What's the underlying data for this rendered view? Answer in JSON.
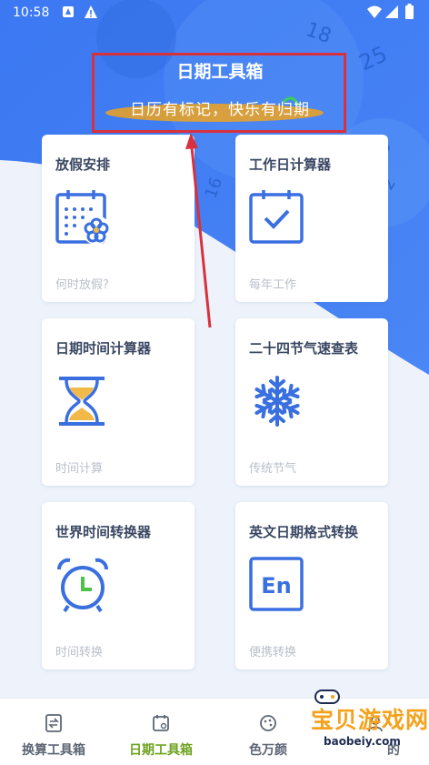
{
  "status_bar": {
    "time": "10:58"
  },
  "header": {
    "title": "日期工具箱",
    "subtitle": "日历有标记，快乐有归期"
  },
  "cards": [
    {
      "title": "放假安排",
      "subtitle": "何时放假?",
      "icon": "calendar-flower-icon"
    },
    {
      "title": "工作日计算器",
      "subtitle": "每年工作",
      "icon": "calendar-check-icon"
    },
    {
      "title": "日期时间计算器",
      "subtitle": "时间计算",
      "icon": "hourglass-icon"
    },
    {
      "title": "二十四节气速查表",
      "subtitle": "传统节气",
      "icon": "snowflake-icon"
    },
    {
      "title": "世界时间转换器",
      "subtitle": "时间转换",
      "icon": "alarm-clock-icon"
    },
    {
      "title": "英文日期格式转换",
      "subtitle": "便携转换",
      "icon": "en-icon"
    }
  ],
  "tabs": [
    {
      "label": "换算工具箱",
      "icon": "converter-icon"
    },
    {
      "label": "日期工具箱",
      "icon": "calendar-tools-icon",
      "active": true
    },
    {
      "label": "色万颜",
      "icon": "palette-icon"
    },
    {
      "label": "的",
      "icon": "user-icon"
    }
  ],
  "watermark": {
    "text": "宝贝游戏网",
    "url": "baobeiy.com"
  },
  "colors": {
    "hero_blue": "#3d7cf0",
    "accent_blue": "#3a6fe0",
    "sand": "#f1b84a",
    "active_green": "#6ea320",
    "annotation_red": "#d9303e"
  }
}
